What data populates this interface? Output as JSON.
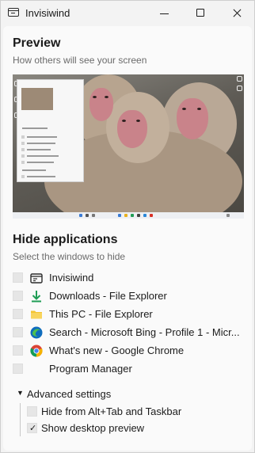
{
  "window": {
    "title": "Invisiwind"
  },
  "preview": {
    "heading": "Preview",
    "subtitle": "How others will see your screen"
  },
  "hide": {
    "heading": "Hide applications",
    "subtitle": "Select the windows to hide",
    "items": [
      {
        "label": "Invisiwind",
        "icon": "invisiwind-icon",
        "checked": false
      },
      {
        "label": "Downloads - File Explorer",
        "icon": "download-icon",
        "checked": false
      },
      {
        "label": "This PC - File Explorer",
        "icon": "folder-icon",
        "checked": false
      },
      {
        "label": "Search - Microsoft Bing - Profile 1 - Micr...",
        "icon": "edge-icon",
        "checked": false
      },
      {
        "label": "What's new - Google Chrome",
        "icon": "chrome-icon",
        "checked": false
      },
      {
        "label": "Program Manager",
        "icon": "",
        "checked": false
      }
    ]
  },
  "advanced": {
    "label": "Advanced settings",
    "expanded": true,
    "options": [
      {
        "label": "Hide from Alt+Tab and Taskbar",
        "checked": false
      },
      {
        "label": "Show desktop preview",
        "checked": true
      }
    ]
  },
  "colors": {
    "accent": "#0f6cbd",
    "download_green": "#1f9d55",
    "folder_yellow": "#f4c430"
  }
}
